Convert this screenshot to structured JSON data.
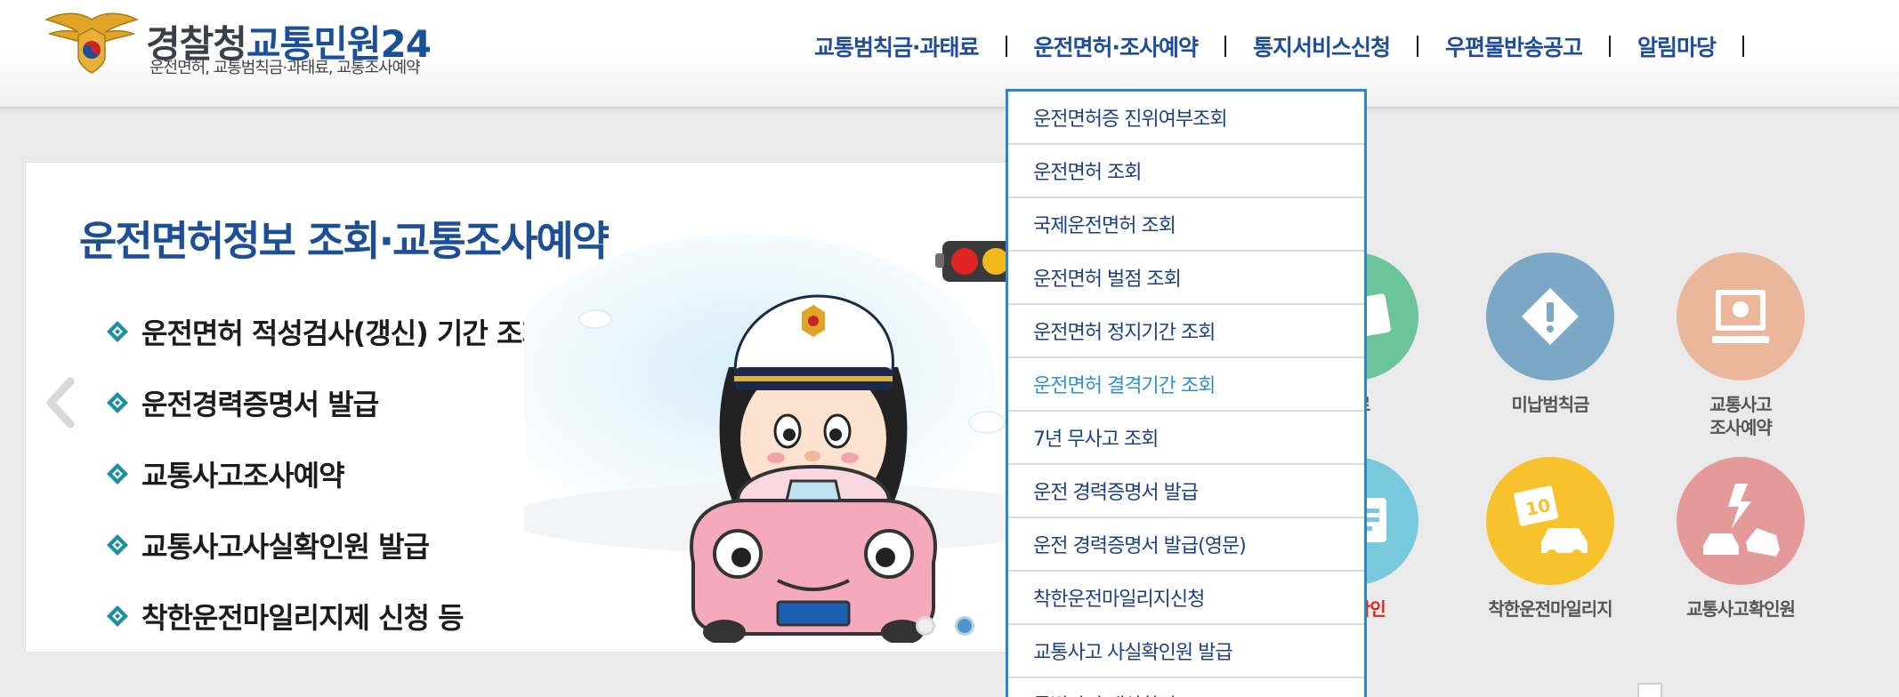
{
  "header": {
    "brand_part1": "경찰청",
    "brand_part2": "교통민원24",
    "brand_sub": "운전면허, 교통범칙금·과태료, 교통조사예약",
    "nav": [
      "교통범칙금·과태료",
      "운전면허·조사예약",
      "통지서비스신청",
      "우편물반송공고",
      "알림마당"
    ]
  },
  "visual": {
    "title": "운전면허정보 조회·교통조사예약",
    "bullets": [
      "운전면허 적성검사(갱신) 기간 조회",
      "운전경력증명서 발급",
      "교통사고조사예약",
      "교통사고사실확인원 발급",
      "착한운전마일리지제 신청 등"
    ],
    "active_slide": 2,
    "slide_count": 2
  },
  "quick_icons": [
    {
      "label": "태료",
      "color": "#6cc59a",
      "icon": "money-icon"
    },
    {
      "label": "미납범칙금",
      "color": "#7ba8c4",
      "icon": "warning-icon"
    },
    {
      "label": "교통사고\n조사예약",
      "color": "#eab79a",
      "icon": "computer-icon"
    },
    {
      "label": "대상확인",
      "color": "#79c9dc",
      "icon": "id-card-icon",
      "highlight": true
    },
    {
      "label": "착한운전마일리지",
      "color": "#f8c22d",
      "icon": "mileage-car-icon"
    },
    {
      "label": "교통사고확인원",
      "color": "#e59a9a",
      "icon": "accident-icon"
    }
  ],
  "dropdown": {
    "items": [
      "운전면허증 진위여부조회",
      "운전면허 조회",
      "국제운전면허 조회",
      "운전면허 벌점 조회",
      "운전면허 정지기간 조회",
      "운전면허 결격기간 조회",
      "7년 무사고 조회",
      "운전 경력증명서 발급",
      "운전 경력증명서 발급(영문)",
      "착한운전마일리지신청",
      "교통사고 사실확인원 발급",
      "특별감면 대상확인"
    ],
    "active_index": 5
  }
}
